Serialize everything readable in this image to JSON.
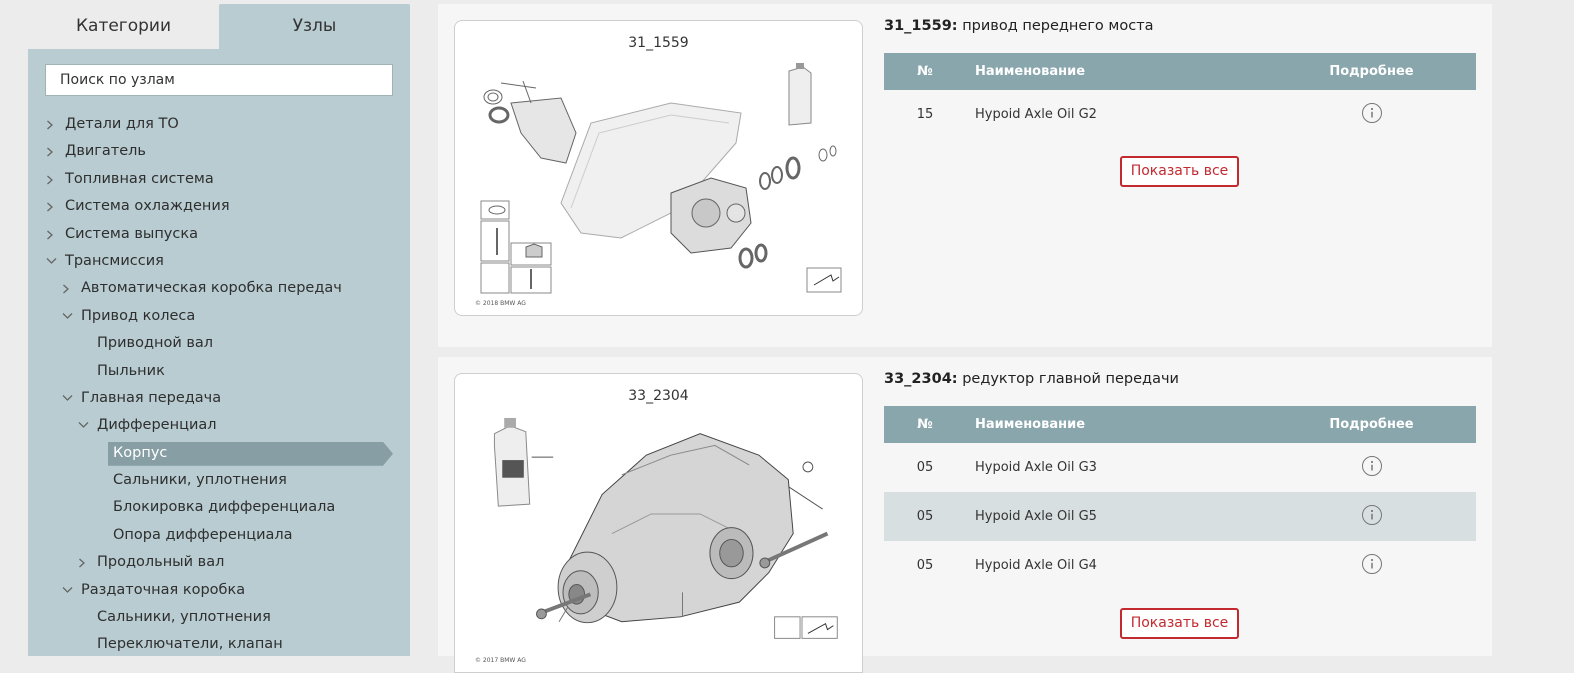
{
  "sidebar": {
    "tabs": [
      "Категории",
      "Узлы"
    ],
    "search_value": "Поиск по узлам",
    "tree": [
      {
        "label": "Детали для ТО",
        "level": 0,
        "chevron": "right"
      },
      {
        "label": "Двигатель",
        "level": 0,
        "chevron": "right"
      },
      {
        "label": "Топливная система",
        "level": 0,
        "chevron": "right"
      },
      {
        "label": "Система охлаждения",
        "level": 0,
        "chevron": "right"
      },
      {
        "label": "Система выпуска",
        "level": 0,
        "chevron": "right"
      },
      {
        "label": "Трансмиссия",
        "level": 0,
        "chevron": "down"
      },
      {
        "label": "Автоматическая коробка передач",
        "level": 1,
        "chevron": "right"
      },
      {
        "label": "Привод колеса",
        "level": 1,
        "chevron": "down"
      },
      {
        "label": "Приводной вал",
        "level": 2,
        "chevron": "none"
      },
      {
        "label": "Пыльник",
        "level": 2,
        "chevron": "none"
      },
      {
        "label": "Главная передача",
        "level": 1,
        "chevron": "down"
      },
      {
        "label": "Дифференциал",
        "level": 2,
        "chevron": "down"
      },
      {
        "label": "Корпус",
        "level": 3,
        "chevron": "none",
        "active": true
      },
      {
        "label": "Сальники, уплотнения",
        "level": 3,
        "chevron": "none"
      },
      {
        "label": "Блокировка дифференциала",
        "level": 3,
        "chevron": "none"
      },
      {
        "label": "Опора дифференциала",
        "level": 3,
        "chevron": "none"
      },
      {
        "label": "Продольный вал",
        "level": 2,
        "chevron": "right"
      },
      {
        "label": "Раздаточная коробка",
        "level": 1,
        "chevron": "down"
      },
      {
        "label": "Сальники, уплотнения",
        "level": 2,
        "chevron": "none"
      },
      {
        "label": "Переключатели, клапан",
        "level": 2,
        "chevron": "none"
      }
    ]
  },
  "columns": {
    "num": "№",
    "name": "Наименование",
    "more": "Подробнее"
  },
  "show_all_label": "Показать все",
  "cards": [
    {
      "code": "31_1559",
      "title_code": "31_1559:",
      "title_text": " привод переднего моста",
      "image_caption": "31_1559",
      "copyright": "© 2018 BMW AG",
      "rows": [
        {
          "num": "15",
          "name": "Hypoid Axle Oil G2"
        }
      ]
    },
    {
      "code": "33_2304",
      "title_code": "33_2304:",
      "title_text": " редуктор главной передачи",
      "image_caption": "33_2304",
      "copyright": "© 2017 BMW AG",
      "rows": [
        {
          "num": "05",
          "name": "Hypoid Axle Oil G3"
        },
        {
          "num": "05",
          "name": "Hypoid Axle Oil G5",
          "highlight": true
        },
        {
          "num": "05",
          "name": "Hypoid Axle Oil G4"
        }
      ]
    }
  ],
  "colors": {
    "sidebar_bg": "#b8ccd1",
    "header_bg": "#88a6ac",
    "active_item_bg": "#869ea4",
    "button_red": "#c22a2f",
    "row_highlight": "#d8dfe1"
  },
  "icons": [
    "chevron-right-icon",
    "chevron-down-icon",
    "info-icon"
  ]
}
